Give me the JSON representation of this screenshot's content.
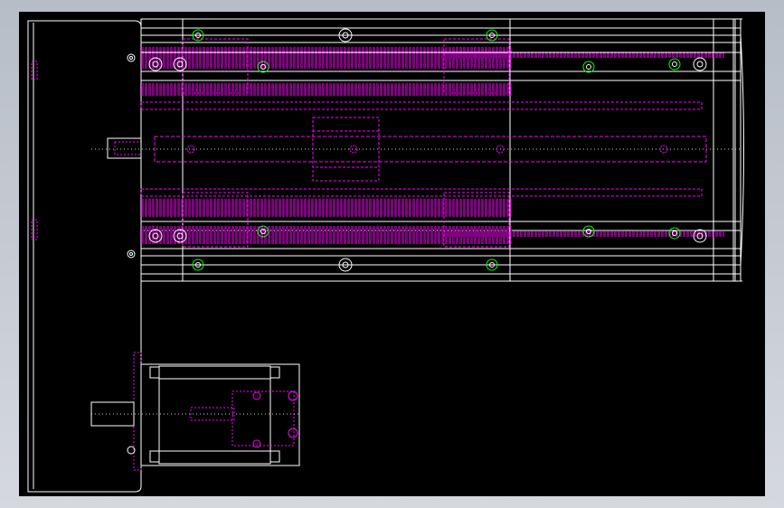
{
  "colors": {
    "outline": "#ffffff",
    "hidden": "#ff00ff",
    "hole": "#00ff00",
    "centerline": "#cfcfcf",
    "background": "#000000",
    "surround": "#c4c9d1"
  },
  "drawing": {
    "views": [
      "top-view-linear-module",
      "motor-side-view",
      "end-bracket-view"
    ],
    "text_labels": []
  }
}
